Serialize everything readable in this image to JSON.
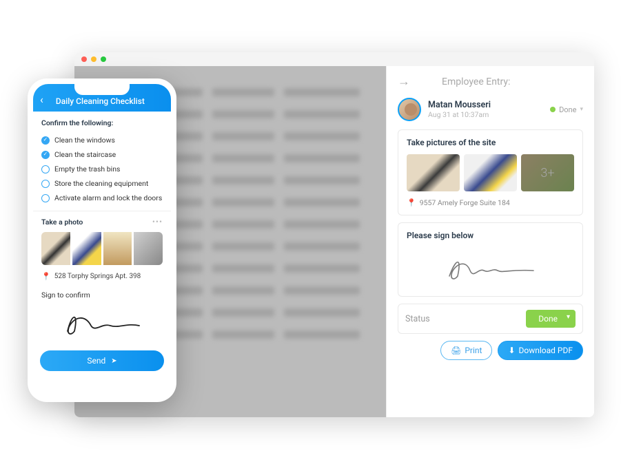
{
  "panel": {
    "title": "Employee Entry:",
    "user": {
      "name": "Matan Mousseri",
      "time": "Aug 31 at 10:37am"
    },
    "status_text": "Done",
    "site_card_title": "Take pictures of the site",
    "extra_photos": "3+",
    "address": "9557 Amely Forge Suite 184",
    "sign_card_title": "Please sign below",
    "status_card_label": "Status",
    "done_button": "Done",
    "print_label": "Print",
    "download_label": "Download PDF"
  },
  "phone": {
    "title": "Daily Cleaning Checklist",
    "confirm_label": "Confirm the following:",
    "checklist": [
      {
        "label": "Clean the windows",
        "checked": true
      },
      {
        "label": "Clean the staircase",
        "checked": true
      },
      {
        "label": "Empty the trash bins",
        "checked": false
      },
      {
        "label": "Store the cleaning equipment",
        "checked": false
      },
      {
        "label": "Activate alarm and lock the doors",
        "checked": false
      }
    ],
    "photo_label": "Take a photo",
    "address": "528 Torphy Springs Apt. 398",
    "sign_label": "Sign to confirm",
    "send_label": "Send"
  }
}
